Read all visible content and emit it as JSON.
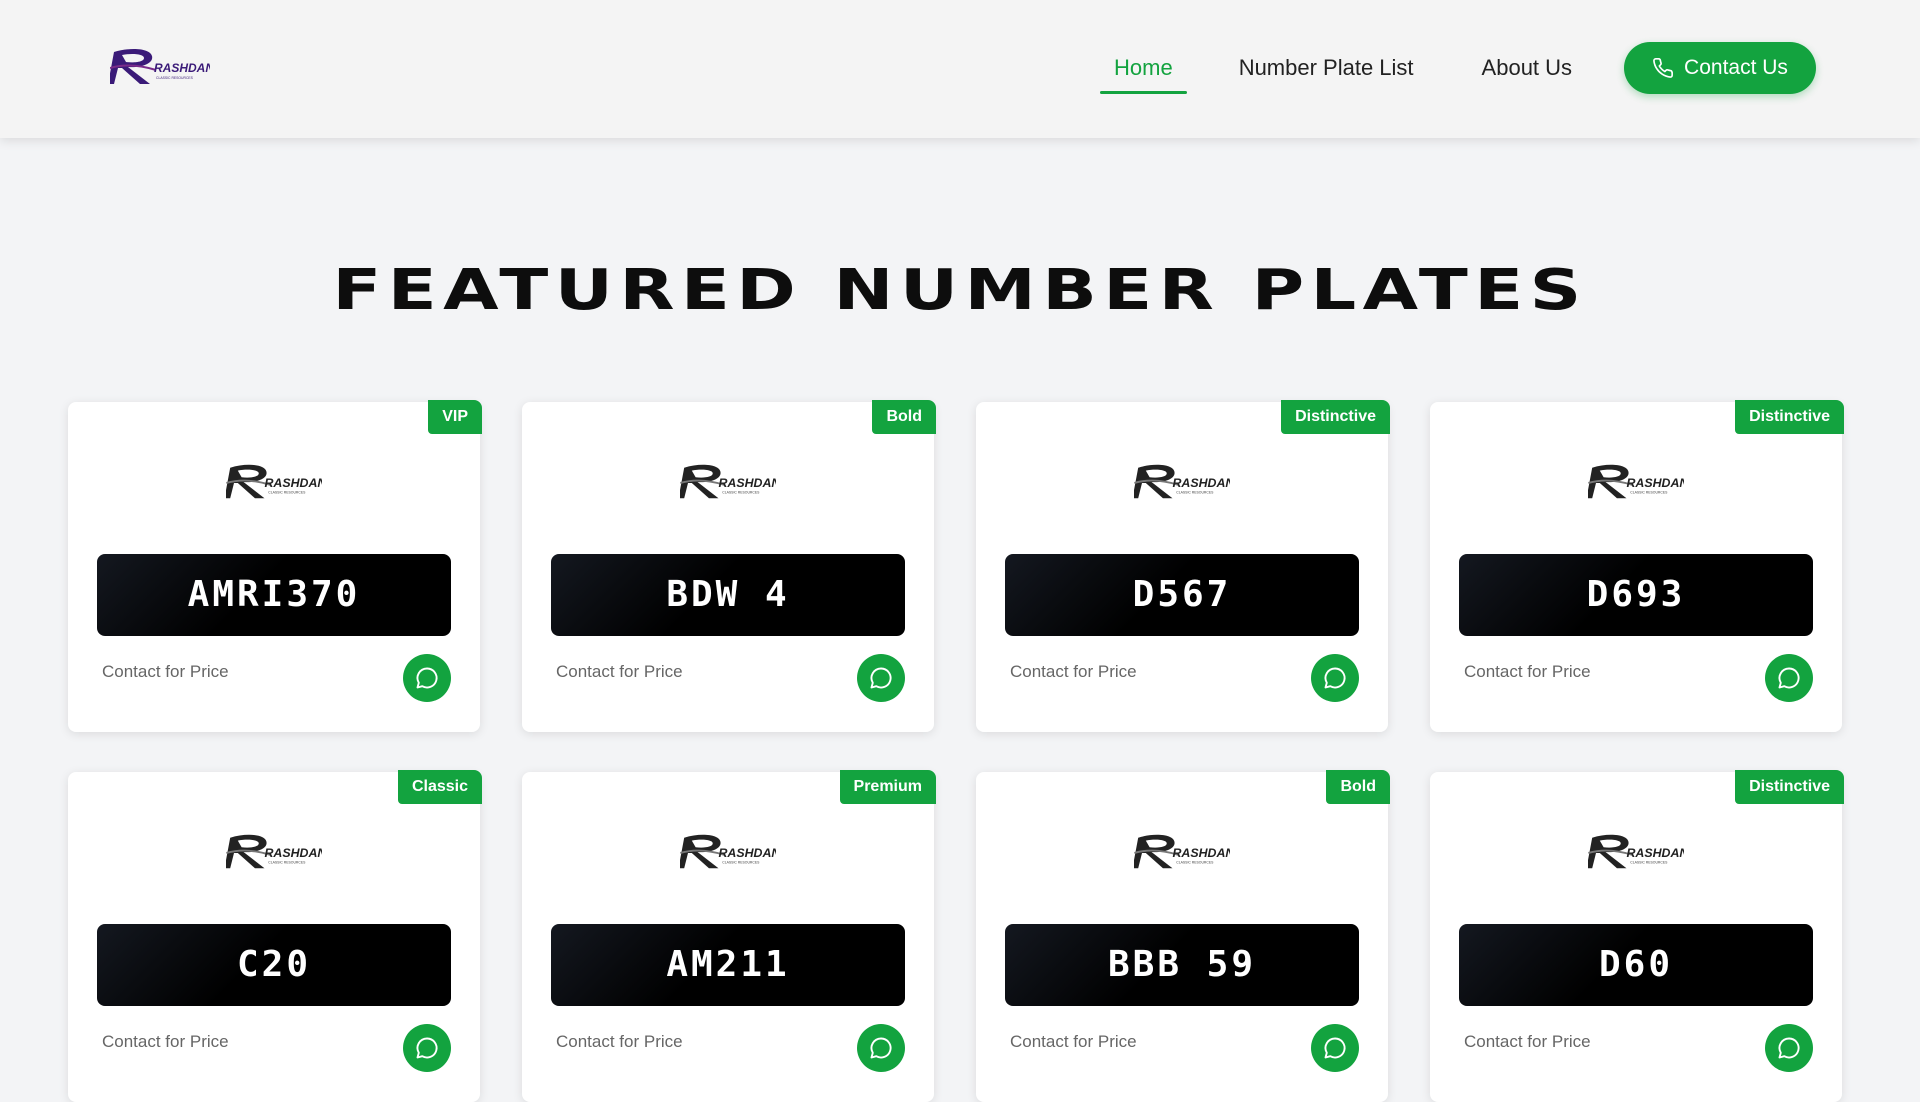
{
  "brand": {
    "name": "RASHDAN",
    "tagline": "CLASSIC RESOURCES"
  },
  "nav": {
    "home": "Home",
    "number_plate_list": "Number Plate List",
    "about_us": "About Us",
    "contact_us": "Contact Us"
  },
  "section": {
    "title": "FEATURED NUMBER PLATES"
  },
  "colors": {
    "accent": "#13a33f",
    "plate_bg": "#000000",
    "page_bg": "#f3f4f6"
  },
  "cards": [
    {
      "badge": "VIP",
      "plate": "AMRI370",
      "price": "Contact for Price",
      "icon": "whatsapp-icon"
    },
    {
      "badge": "Bold",
      "plate": "BDW 4",
      "price": "Contact for Price",
      "icon": "whatsapp-icon"
    },
    {
      "badge": "Distinctive",
      "plate": "D567",
      "price": "Contact for Price",
      "icon": "whatsapp-icon"
    },
    {
      "badge": "Distinctive",
      "plate": "D693",
      "price": "Contact for Price",
      "icon": "whatsapp-icon"
    },
    {
      "badge": "Classic",
      "plate": "C20",
      "price": "Contact for Price",
      "icon": "whatsapp-icon"
    },
    {
      "badge": "Premium",
      "plate": "AM211",
      "price": "Contact for Price",
      "icon": "whatsapp-icon"
    },
    {
      "badge": "Bold",
      "plate": "BBB 59",
      "price": "Contact for Price",
      "icon": "whatsapp-icon"
    },
    {
      "badge": "Distinctive",
      "plate": "D60",
      "price": "Contact for Price",
      "icon": "whatsapp-icon"
    }
  ]
}
